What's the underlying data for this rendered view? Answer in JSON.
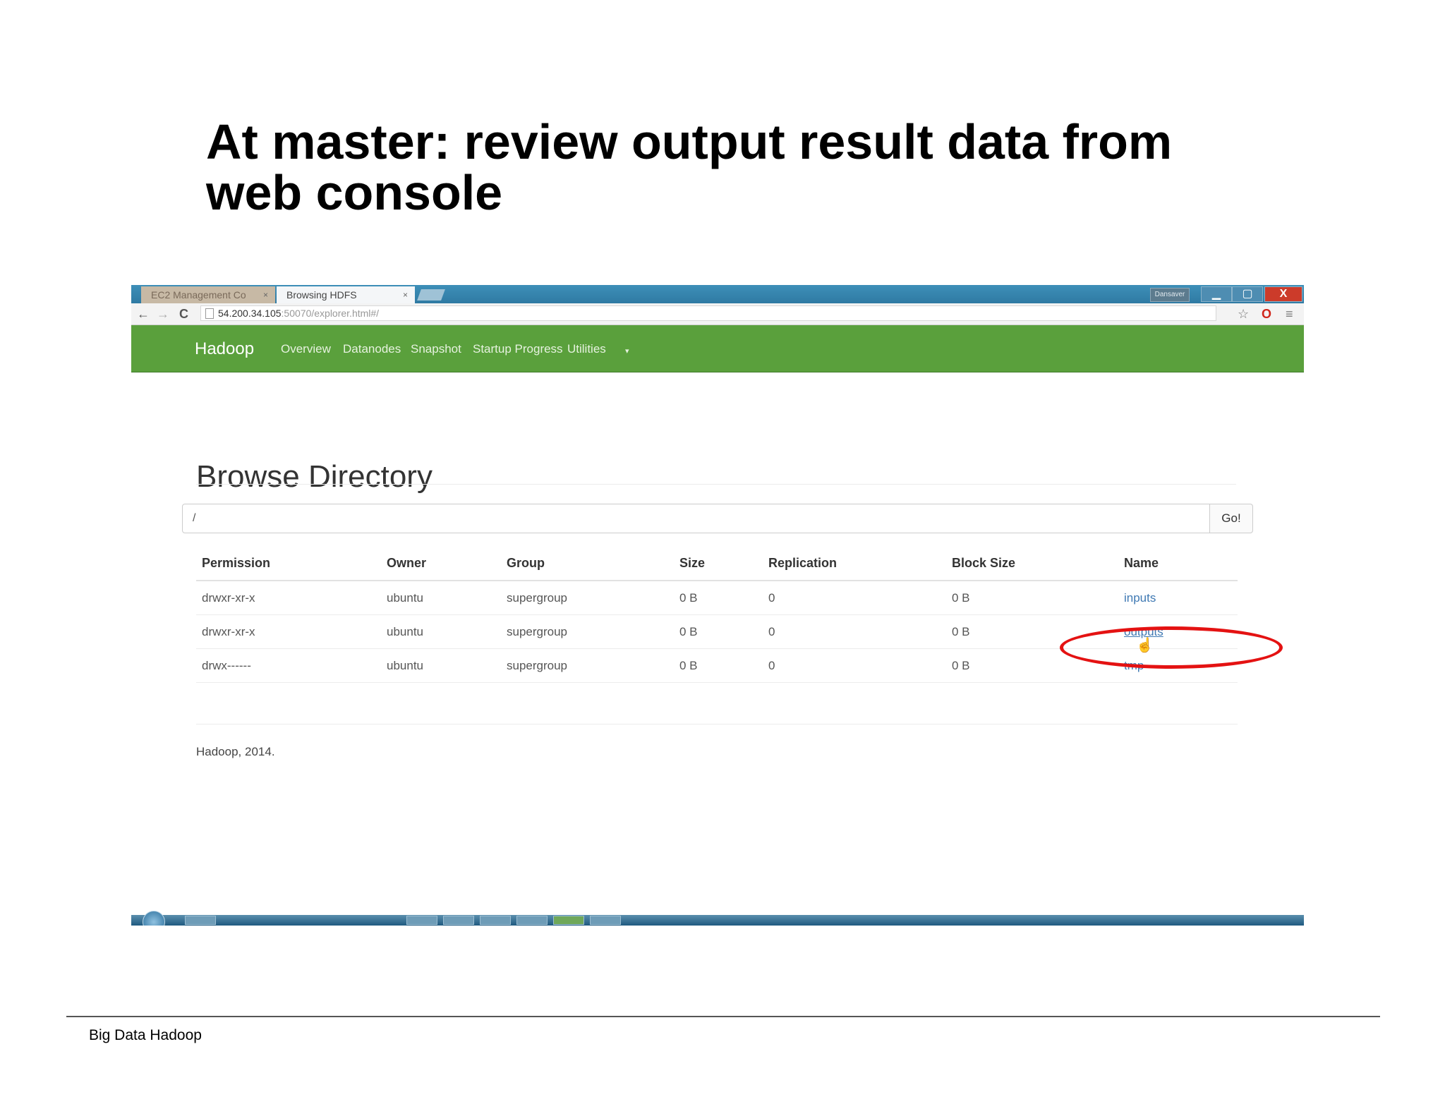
{
  "slide": {
    "title_line1": "At master: review output result data from",
    "title_line2": "web console",
    "footer": "Big Data Hadoop"
  },
  "browser": {
    "tabs": [
      {
        "label": "EC2 Management Co",
        "close": "×"
      },
      {
        "label": "Browsing HDFS",
        "close": "×"
      }
    ],
    "window_user": "Dansaver",
    "window_controls": {
      "minimize": "▁",
      "maximize": "▢",
      "close": "X"
    },
    "nav": {
      "back": "←",
      "forward": "→",
      "reload": "C"
    },
    "url": {
      "host": "54.200.34.105",
      "rest": ":50070/explorer.html#/"
    },
    "toolbar": {
      "star": "☆",
      "opera": "O",
      "menu": "≡"
    }
  },
  "hadoop": {
    "brand": "Hadoop",
    "nav": [
      "Overview",
      "Datanodes",
      "Snapshot",
      "Startup Progress",
      "Utilities"
    ],
    "page_title": "Browse Directory",
    "path_value": "/",
    "go_label": "Go!",
    "columns": [
      "Permission",
      "Owner",
      "Group",
      "Size",
      "Replication",
      "Block Size",
      "Name"
    ],
    "rows": [
      {
        "permission": "drwxr-xr-x",
        "owner": "ubuntu",
        "group": "supergroup",
        "size": "0 B",
        "replication": "0",
        "block_size": "0 B",
        "name": "inputs"
      },
      {
        "permission": "drwxr-xr-x",
        "owner": "ubuntu",
        "group": "supergroup",
        "size": "0 B",
        "replication": "0",
        "block_size": "0 B",
        "name": "outputs"
      },
      {
        "permission": "drwx------",
        "owner": "ubuntu",
        "group": "supergroup",
        "size": "0 B",
        "replication": "0",
        "block_size": "0 B",
        "name": "tmp"
      }
    ],
    "footer": "Hadoop, 2014."
  },
  "colors": {
    "nav_green": "#5aa03c",
    "link_blue": "#3f79b3",
    "annotation_red": "#e41212"
  }
}
